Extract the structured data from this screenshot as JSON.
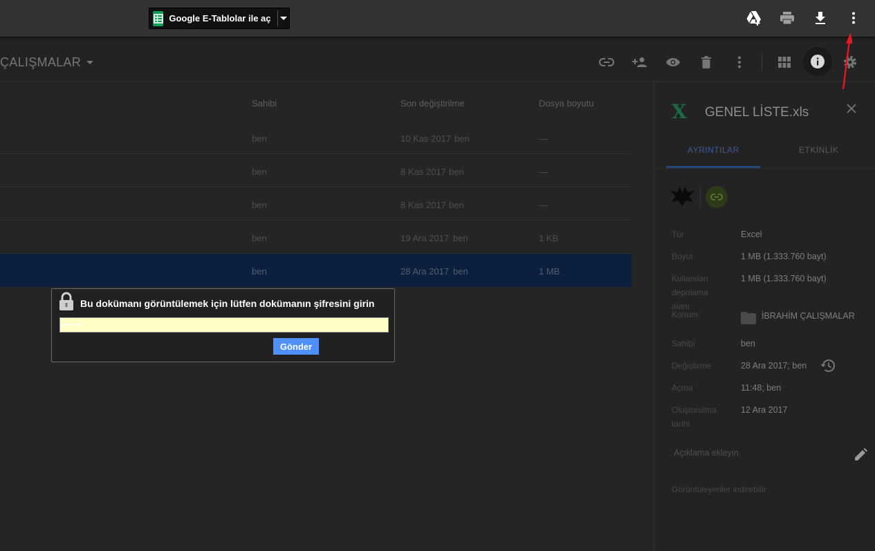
{
  "topbar": {
    "open_with_label": "Google E-Tablolar ile aç",
    "icons": [
      "add-to-drive-icon",
      "print-icon",
      "download-icon",
      "more-vert-icon"
    ]
  },
  "toolbar": {
    "breadcrumb": "ÇALIŞMALAR",
    "icons": [
      "link-icon",
      "add-person-icon",
      "preview-icon",
      "trash-icon",
      "more-vert-icon",
      "grid-view-icon",
      "info-icon",
      "settings-icon"
    ]
  },
  "file_list": {
    "columns": [
      "Sahibi",
      "Son değiştirilme",
      "Dosya boyutu"
    ],
    "rows": [
      {
        "owner": "ben",
        "modified": "10 Kas 2017",
        "modified_by": "ben",
        "size": "—"
      },
      {
        "owner": "ben",
        "modified": "8 Kas 2017",
        "modified_by": "ben",
        "size": "—"
      },
      {
        "owner": "ben",
        "modified": "8 Kas 2017",
        "modified_by": "ben",
        "size": "—"
      },
      {
        "owner": "ben",
        "modified": "19 Ara 2017",
        "modified_by": "ben",
        "size": "1 KB"
      },
      {
        "owner": "ben",
        "modified": "28 Ara 2017",
        "modified_by": "ben",
        "size": "1 MB"
      }
    ],
    "selected_index": 4
  },
  "details": {
    "file_icon": "X",
    "file_name": "GENEL LİSTE.xls",
    "tabs": [
      "AYRINTILAR",
      "ETKİNLİK"
    ],
    "active_tab": 0,
    "properties": {
      "type_label": "Tür",
      "type_value": "Excel",
      "size_label": "Boyut",
      "size_value": "1 MB (1.333.760 bayt)",
      "storage_label": "Kullanılan depolama alanı",
      "storage_value": "1 MB (1.333.760 bayt)",
      "location_label": "Konum",
      "location_value": "İBRAHİM ÇALIŞMALAR",
      "owner_label": "Sahibi",
      "owner_value": "ben",
      "modified_label": "Değiştirme",
      "modified_value": "28 Ara 2017; ben",
      "opened_label": "Açma",
      "opened_value": "11:48; ben",
      "created_label": "Oluşturulma tarihi",
      "created_value": "12 Ara 2017"
    },
    "description_placeholder": "Açıklama ekleyin",
    "download_note": "Görüntüleyenler indirebilir"
  },
  "password_dialog": {
    "prompt": "Bu dokümanı görüntülemek için lütfen dokümanın şifresini girin",
    "input_value": "••••••••",
    "submit_label": "Gönder"
  },
  "colors": {
    "accent_blue": "#4d90fe",
    "selected_row": "#0d1f3e",
    "sheets_green": "#0f9d58",
    "annotation_arrow": "#e8171f"
  }
}
